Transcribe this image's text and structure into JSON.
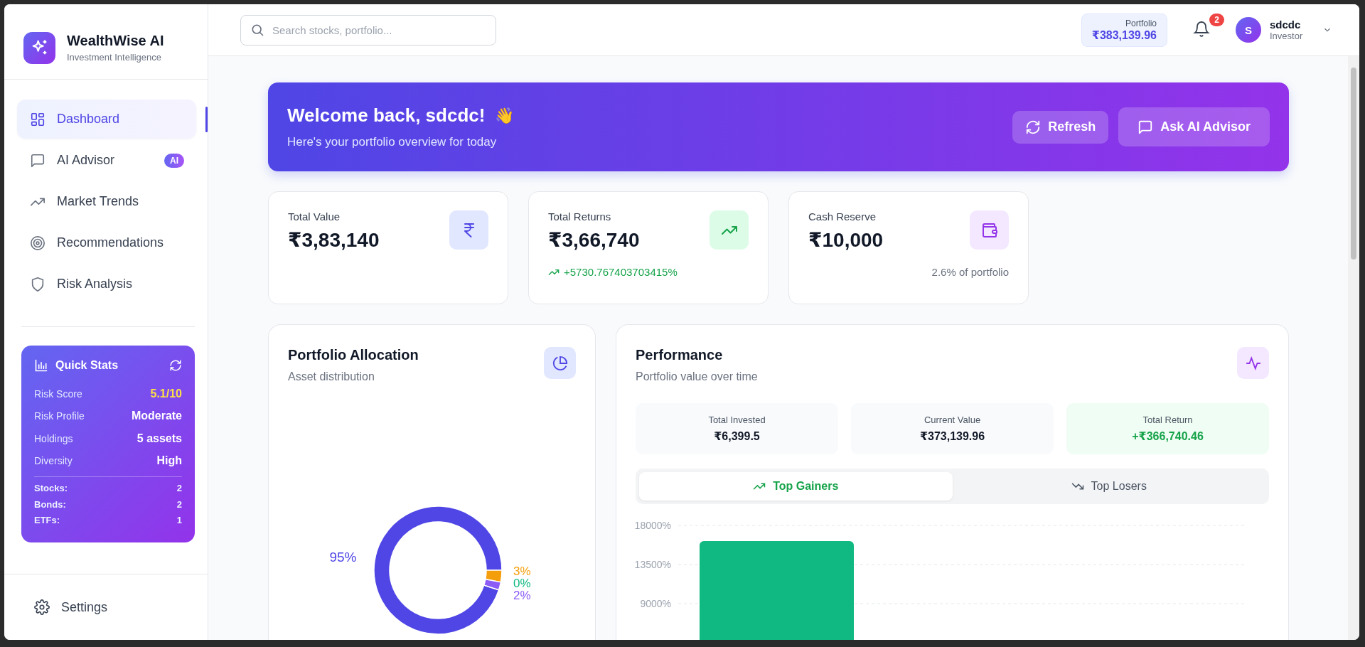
{
  "brand": {
    "name": "WealthWise AI",
    "tagline": "Investment Intelligence"
  },
  "nav": [
    {
      "label": "Dashboard",
      "selected": true
    },
    {
      "label": "AI Advisor",
      "badge": "AI",
      "selected": false
    },
    {
      "label": "Market Trends",
      "selected": false
    },
    {
      "label": "Recommendations",
      "selected": false
    },
    {
      "label": "Risk Analysis",
      "selected": false
    }
  ],
  "quick_stats": {
    "title": "Quick Stats",
    "rows": [
      {
        "label": "Risk Score",
        "value": "5.1/10",
        "kind": "highlight"
      },
      {
        "label": "Risk Profile",
        "value": "Moderate",
        "kind": "plain"
      },
      {
        "label": "Holdings",
        "value": "5 assets",
        "kind": "plain"
      },
      {
        "label": "Diversity",
        "value": "High",
        "kind": "plain"
      }
    ],
    "counts": [
      {
        "label": "Stocks:",
        "value": "2"
      },
      {
        "label": "Bonds:",
        "value": "2"
      },
      {
        "label": "ETFs:",
        "value": "1"
      }
    ]
  },
  "settings": {
    "label": "Settings"
  },
  "search": {
    "placeholder": "Search stocks, portfolio..."
  },
  "portfolio_chip": {
    "label": "Portfolio",
    "value": "₹383,139.96"
  },
  "notifications": {
    "count": "2"
  },
  "user": {
    "initial": "S",
    "name": "sdcdc",
    "role": "Investor"
  },
  "welcome": {
    "title": "Welcome back, sdcdc!",
    "emoji": "👋",
    "subtitle": "Here's your portfolio overview for today"
  },
  "buttons": [
    {
      "label": "Refresh"
    },
    {
      "label": "Ask AI Advisor"
    }
  ],
  "cards": [
    {
      "label": "Total Value",
      "value": "₹3,83,140"
    },
    {
      "label": "Total Returns",
      "value": "₹3,66,740",
      "change": "+5730.767403703415%"
    },
    {
      "label": "Cash Reserve",
      "value": "₹10,000",
      "note": "2.6% of portfolio"
    }
  ],
  "allocation": {
    "title": "Portfolio Allocation",
    "subtitle": "Asset distribution",
    "chart_data": {
      "type": "donut",
      "values": [
        95,
        3,
        0,
        2
      ],
      "value_labels": [
        "95%",
        "3%",
        "0%",
        "2%"
      ]
    }
  },
  "performance": {
    "title": "Performance",
    "subtitle": "Portfolio value over time",
    "summary": [
      {
        "label": "Total Invested",
        "value": "₹6,399.5",
        "kind": "neutral"
      },
      {
        "label": "Current Value",
        "value": "₹373,139.96",
        "kind": "neutral"
      },
      {
        "label": "Total Return",
        "value": "+₹366,740.46",
        "kind": "positive"
      }
    ],
    "tabs": [
      {
        "label": "Top Gainers",
        "selected": true
      },
      {
        "label": "Top Losers",
        "selected": false
      }
    ],
    "chart_data": {
      "type": "bar",
      "series": [
        {
          "color": "#10b981",
          "values": [
            16200
          ]
        }
      ],
      "ylim": [
        0,
        18000
      ],
      "yticks": [
        {
          "value": 9000,
          "label": "9000%"
        },
        {
          "value": 13500,
          "label": "13500%"
        },
        {
          "value": 18000,
          "label": "18000%"
        }
      ]
    }
  }
}
